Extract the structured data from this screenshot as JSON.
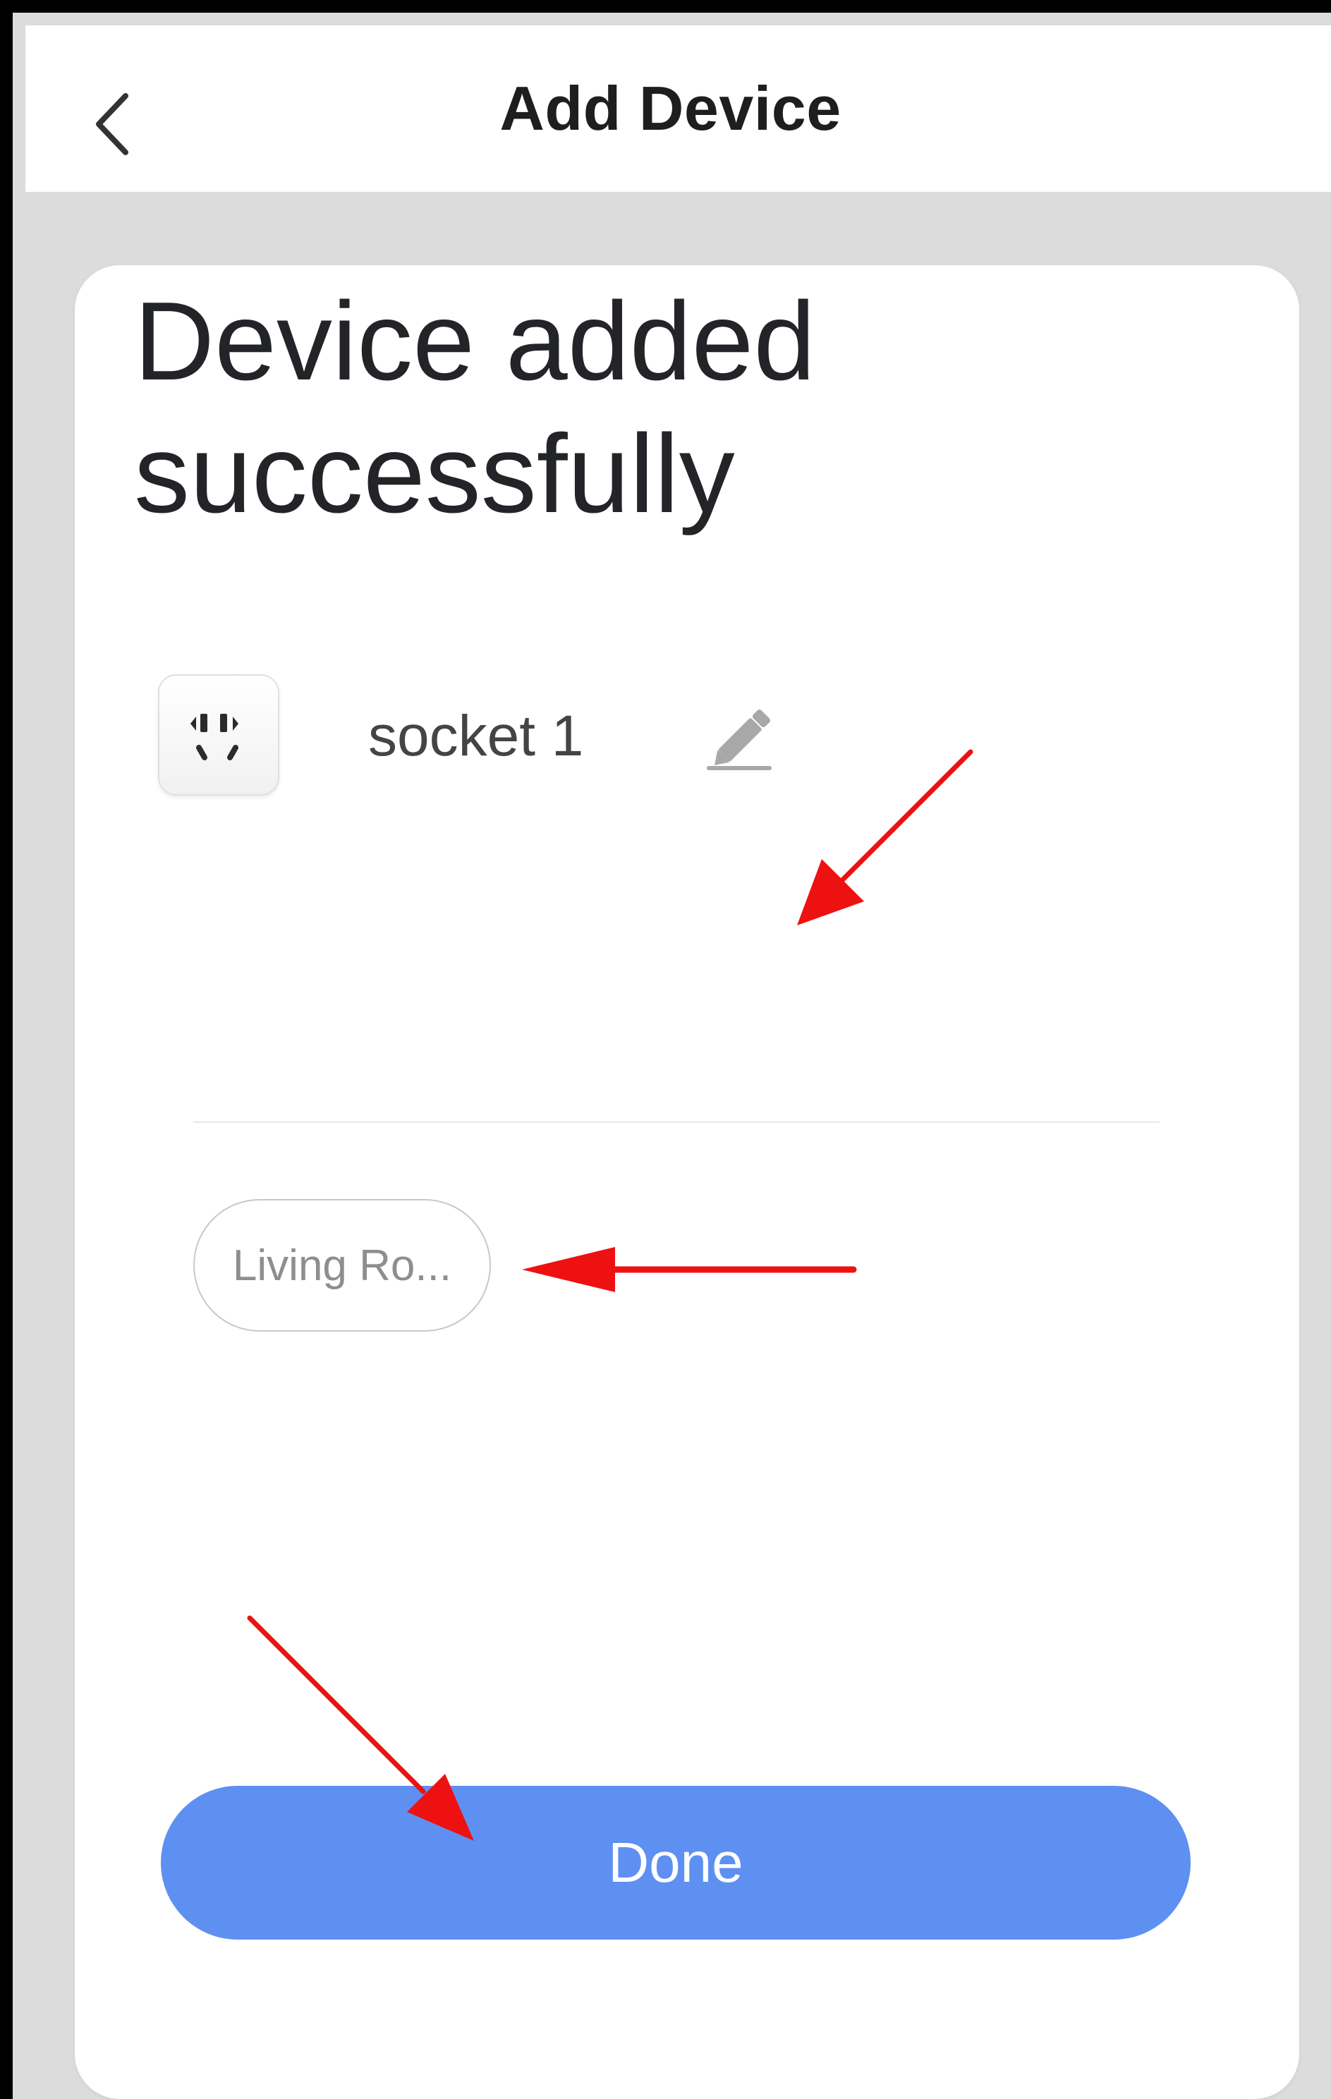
{
  "header": {
    "title": "Add Device",
    "back_icon": "chevron-left-icon"
  },
  "card": {
    "success_message": "Device added successfully",
    "device": {
      "name": "socket 1",
      "icon": "power-socket-icon",
      "edit_icon": "pencil-icon"
    },
    "room_chip": {
      "label": "Living Ro..."
    },
    "done_label": "Done"
  },
  "colors": {
    "background": "#dcdcdc",
    "card": "#ffffff",
    "primary_button": "#5e90f2",
    "title_text": "#222428",
    "annotation_arrow": "#ee1111"
  }
}
